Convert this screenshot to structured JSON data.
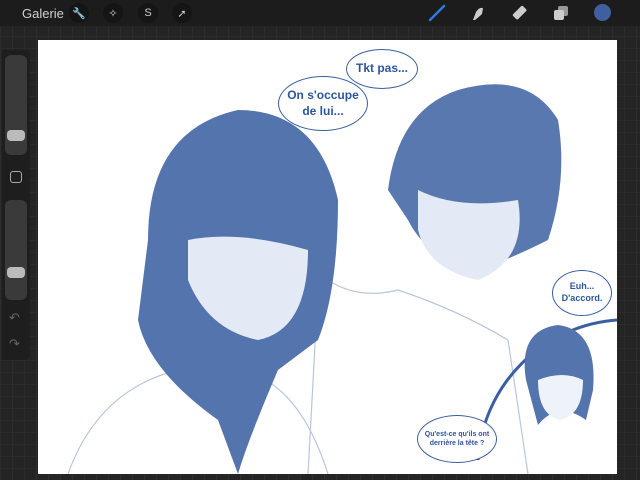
{
  "topbar": {
    "gallery_label": "Galerie",
    "color_swatch": "#3f5f9e",
    "brush_color": "#2b7be0"
  },
  "tools_left": [
    "wrench-icon",
    "magic-wand-icon",
    "selection-icon",
    "transform-arrow-icon"
  ],
  "tools_right": [
    "brush-icon",
    "smudge-icon",
    "eraser-icon",
    "layers-icon",
    "color-icon"
  ],
  "sidebar": {
    "brush_size": 0.2,
    "opacity": 0.25
  },
  "bubbles": {
    "tkt": "Tkt pas...",
    "occupe_1": "On s'occupe",
    "occupe_2": "de lui...",
    "euh_1": "Euh...",
    "euh_2": "D'accord.",
    "thought_1": "Qu'est-ce qu'ils ont",
    "thought_2": "derrière la tête ?"
  },
  "colors": {
    "ink": "#3f5f9e",
    "light": "#dde4f0"
  }
}
